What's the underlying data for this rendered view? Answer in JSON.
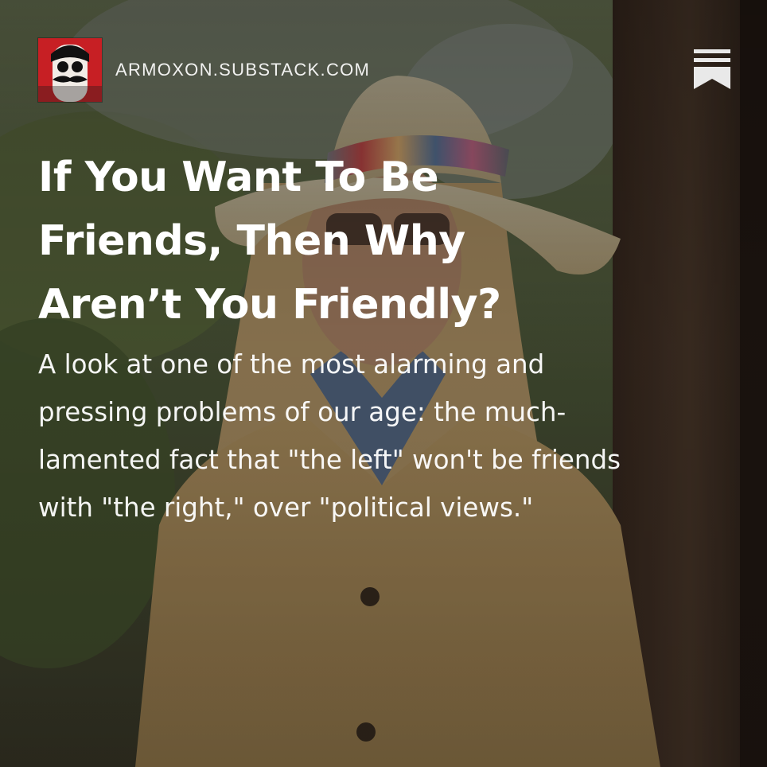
{
  "publication": {
    "domain": "ARMOXON.SUBSTACK.COM",
    "avatar_icon": "publication-avatar-mustache-face",
    "bookmark_icon": "substack-bookmark-icon"
  },
  "post": {
    "title": "If You Want To Be Friends, Then Why Aren’t You Friendly?",
    "subtitle": "A look at one of the most alarming and pressing problems of our age: the much-lamented fact that \"the left\" won't be friends with \"the right,\" over \"political views.\""
  },
  "colors": {
    "text": "#ffffff",
    "avatar_background": "#c71f24"
  }
}
